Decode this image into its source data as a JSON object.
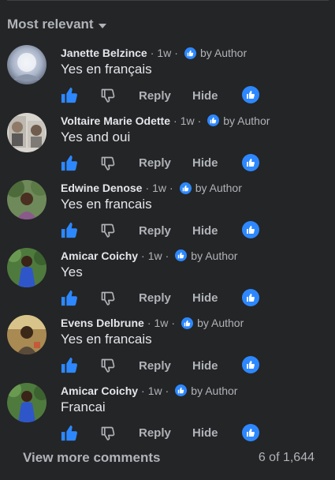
{
  "sort": {
    "label": "Most relevant"
  },
  "comments": [
    {
      "author": "Janette Belzince",
      "time": "1w",
      "badge": "by Author",
      "text": "Yes en français"
    },
    {
      "author": "Voltaire Marie Odette",
      "time": "1w",
      "badge": "by Author",
      "text": "Yes and oui"
    },
    {
      "author": "Edwine Denose",
      "time": "1w",
      "badge": "by Author",
      "text": "Yes en francais"
    },
    {
      "author": "Amicar Coichy",
      "time": "1w",
      "badge": "by Author",
      "text": "Yes"
    },
    {
      "author": "Evens Delbrune",
      "time": "1w",
      "badge": "by Author",
      "text": "Yes en francais"
    },
    {
      "author": "Amicar Coichy",
      "time": "1w",
      "badge": "by Author",
      "text": "Francai"
    }
  ],
  "actions": {
    "reply": "Reply",
    "hide": "Hide"
  },
  "footer": {
    "view_more": "View more comments",
    "count": "6 of 1,644"
  },
  "colors": {
    "background": "#242526",
    "accent": "#2d88ff",
    "muted": "#b0b3b8",
    "text": "#e4e6eb"
  },
  "icons": {
    "like": "thumbs-up-icon",
    "dislike": "thumbs-down-icon",
    "sort": "chevron-down-icon"
  }
}
